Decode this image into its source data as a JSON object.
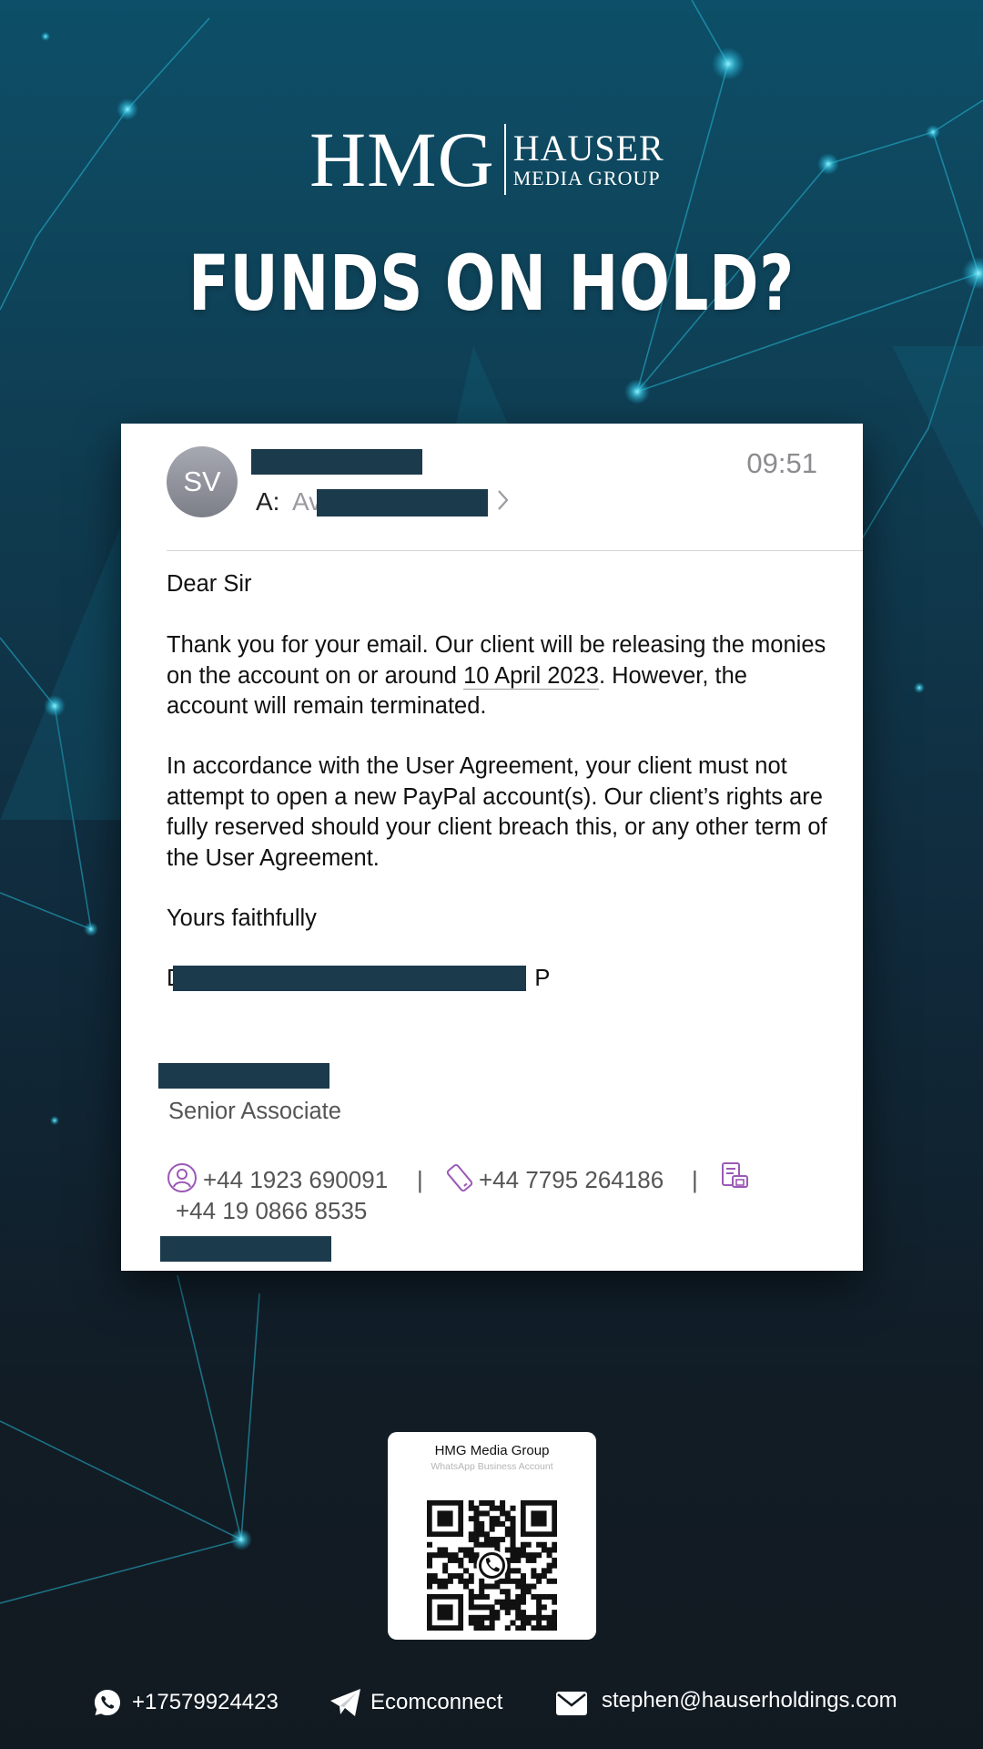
{
  "logo": {
    "mark": "HMG",
    "line1": "HAUSER",
    "line2": "MEDIA GROUP"
  },
  "headline": "FUNDS ON HOLD?",
  "email": {
    "avatar_initials": "SV",
    "to_label": "A:",
    "to_value_visible": "Av",
    "time": "09:51",
    "greeting": "Dear Sir",
    "p1_before": "Thank you for your email. Our client will be releasing the monies on the account on or around ",
    "p1_date": "10 April 2023",
    "p1_after": ". However, the account will remain terminated.",
    "p2": "In accordance with the User Agreement, your client must not attempt to open a new PayPal account(s). Our client’s rights are fully reserved should your client breach this, or any other term of the User Agreement.",
    "closing": "Yours faithfully",
    "sign_first": "D",
    "sign_last": "P",
    "signature_title": "Senior Associate",
    "phone_1": "+44 1923 690091",
    "phone_2": "+44 7795 264186",
    "phone_3": "+44 19 0866 8535",
    "separator": "|"
  },
  "whatsapp_card": {
    "name": "HMG Media Group",
    "subtitle": "WhatsApp Business Account"
  },
  "footer": {
    "whatsapp": "+17579924423",
    "telegram": "Ecomconnect",
    "email": "stephen@hauserholdings.com"
  },
  "colors": {
    "redaction": "#1b3a4b",
    "accent_purple": "#9b59b6",
    "bg_top": "#0d4f68",
    "bg_bottom": "#121a21"
  },
  "icons": [
    "contact-icon",
    "mobile-icon",
    "fax-icon",
    "whatsapp-icon",
    "telegram-icon",
    "mail-icon",
    "chevron-right-icon"
  ]
}
